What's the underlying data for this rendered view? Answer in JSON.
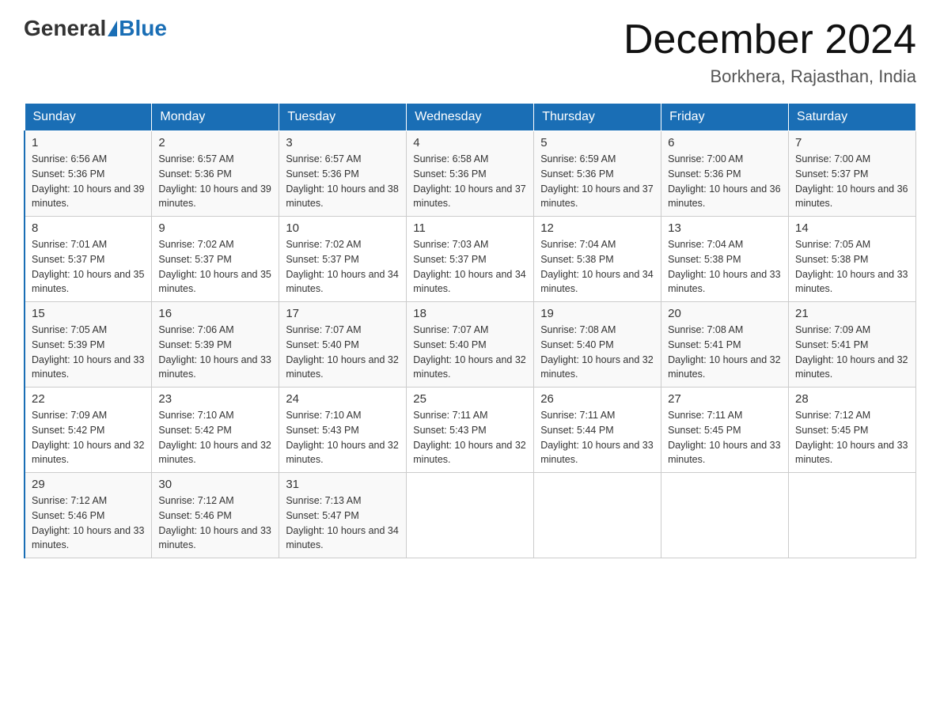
{
  "header": {
    "logo": {
      "general_text": "General",
      "blue_text": "Blue"
    },
    "title": "December 2024",
    "location": "Borkhera, Rajasthan, India"
  },
  "calendar": {
    "days_of_week": [
      "Sunday",
      "Monday",
      "Tuesday",
      "Wednesday",
      "Thursday",
      "Friday",
      "Saturday"
    ],
    "weeks": [
      [
        {
          "day": "1",
          "sunrise": "6:56 AM",
          "sunset": "5:36 PM",
          "daylight": "10 hours and 39 minutes."
        },
        {
          "day": "2",
          "sunrise": "6:57 AM",
          "sunset": "5:36 PM",
          "daylight": "10 hours and 39 minutes."
        },
        {
          "day": "3",
          "sunrise": "6:57 AM",
          "sunset": "5:36 PM",
          "daylight": "10 hours and 38 minutes."
        },
        {
          "day": "4",
          "sunrise": "6:58 AM",
          "sunset": "5:36 PM",
          "daylight": "10 hours and 37 minutes."
        },
        {
          "day": "5",
          "sunrise": "6:59 AM",
          "sunset": "5:36 PM",
          "daylight": "10 hours and 37 minutes."
        },
        {
          "day": "6",
          "sunrise": "7:00 AM",
          "sunset": "5:36 PM",
          "daylight": "10 hours and 36 minutes."
        },
        {
          "day": "7",
          "sunrise": "7:00 AM",
          "sunset": "5:37 PM",
          "daylight": "10 hours and 36 minutes."
        }
      ],
      [
        {
          "day": "8",
          "sunrise": "7:01 AM",
          "sunset": "5:37 PM",
          "daylight": "10 hours and 35 minutes."
        },
        {
          "day": "9",
          "sunrise": "7:02 AM",
          "sunset": "5:37 PM",
          "daylight": "10 hours and 35 minutes."
        },
        {
          "day": "10",
          "sunrise": "7:02 AM",
          "sunset": "5:37 PM",
          "daylight": "10 hours and 34 minutes."
        },
        {
          "day": "11",
          "sunrise": "7:03 AM",
          "sunset": "5:37 PM",
          "daylight": "10 hours and 34 minutes."
        },
        {
          "day": "12",
          "sunrise": "7:04 AM",
          "sunset": "5:38 PM",
          "daylight": "10 hours and 34 minutes."
        },
        {
          "day": "13",
          "sunrise": "7:04 AM",
          "sunset": "5:38 PM",
          "daylight": "10 hours and 33 minutes."
        },
        {
          "day": "14",
          "sunrise": "7:05 AM",
          "sunset": "5:38 PM",
          "daylight": "10 hours and 33 minutes."
        }
      ],
      [
        {
          "day": "15",
          "sunrise": "7:05 AM",
          "sunset": "5:39 PM",
          "daylight": "10 hours and 33 minutes."
        },
        {
          "day": "16",
          "sunrise": "7:06 AM",
          "sunset": "5:39 PM",
          "daylight": "10 hours and 33 minutes."
        },
        {
          "day": "17",
          "sunrise": "7:07 AM",
          "sunset": "5:40 PM",
          "daylight": "10 hours and 32 minutes."
        },
        {
          "day": "18",
          "sunrise": "7:07 AM",
          "sunset": "5:40 PM",
          "daylight": "10 hours and 32 minutes."
        },
        {
          "day": "19",
          "sunrise": "7:08 AM",
          "sunset": "5:40 PM",
          "daylight": "10 hours and 32 minutes."
        },
        {
          "day": "20",
          "sunrise": "7:08 AM",
          "sunset": "5:41 PM",
          "daylight": "10 hours and 32 minutes."
        },
        {
          "day": "21",
          "sunrise": "7:09 AM",
          "sunset": "5:41 PM",
          "daylight": "10 hours and 32 minutes."
        }
      ],
      [
        {
          "day": "22",
          "sunrise": "7:09 AM",
          "sunset": "5:42 PM",
          "daylight": "10 hours and 32 minutes."
        },
        {
          "day": "23",
          "sunrise": "7:10 AM",
          "sunset": "5:42 PM",
          "daylight": "10 hours and 32 minutes."
        },
        {
          "day": "24",
          "sunrise": "7:10 AM",
          "sunset": "5:43 PM",
          "daylight": "10 hours and 32 minutes."
        },
        {
          "day": "25",
          "sunrise": "7:11 AM",
          "sunset": "5:43 PM",
          "daylight": "10 hours and 32 minutes."
        },
        {
          "day": "26",
          "sunrise": "7:11 AM",
          "sunset": "5:44 PM",
          "daylight": "10 hours and 33 minutes."
        },
        {
          "day": "27",
          "sunrise": "7:11 AM",
          "sunset": "5:45 PM",
          "daylight": "10 hours and 33 minutes."
        },
        {
          "day": "28",
          "sunrise": "7:12 AM",
          "sunset": "5:45 PM",
          "daylight": "10 hours and 33 minutes."
        }
      ],
      [
        {
          "day": "29",
          "sunrise": "7:12 AM",
          "sunset": "5:46 PM",
          "daylight": "10 hours and 33 minutes."
        },
        {
          "day": "30",
          "sunrise": "7:12 AM",
          "sunset": "5:46 PM",
          "daylight": "10 hours and 33 minutes."
        },
        {
          "day": "31",
          "sunrise": "7:13 AM",
          "sunset": "5:47 PM",
          "daylight": "10 hours and 34 minutes."
        },
        null,
        null,
        null,
        null
      ]
    ]
  }
}
